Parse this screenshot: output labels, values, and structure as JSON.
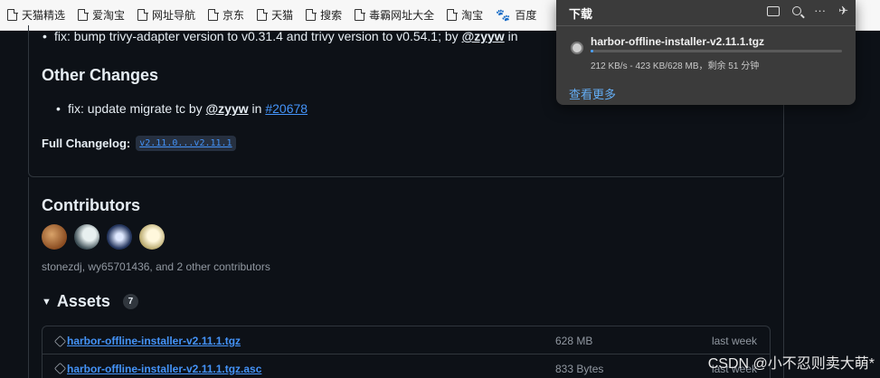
{
  "bookmarks": [
    {
      "label": "天猫精选",
      "icon": "page-icon"
    },
    {
      "label": "爱淘宝",
      "icon": "page-icon"
    },
    {
      "label": "网址导航",
      "icon": "page-icon"
    },
    {
      "label": "京东",
      "icon": "page-icon"
    },
    {
      "label": "天猫",
      "icon": "page-icon"
    },
    {
      "label": "搜索",
      "icon": "page-icon"
    },
    {
      "label": "毒霸网址大全",
      "icon": "page-icon"
    },
    {
      "label": "淘宝",
      "icon": "page-icon"
    },
    {
      "label": "百度",
      "icon": "paw-icon"
    }
  ],
  "release": {
    "line1_text": "fix: bump trivy-adapter version to v0.31.4 and trivy version to v0.54.1; by",
    "line1_user": "@zyyw",
    "line1_in": "in",
    "other_changes_title": "Other Changes",
    "fix2_text": "fix: update migrate tc by",
    "fix2_user": "@zyyw",
    "fix2_in": "in",
    "fix2_pr": "#20678",
    "changelog_label": "Full Changelog:",
    "changelog_range": "v2.11.0...v2.11.1"
  },
  "contributors": {
    "title": "Contributors",
    "names": "stonezdj, wy65701436, and 2 other contributors"
  },
  "assets": {
    "title": "Assets",
    "count": "7",
    "rows": [
      {
        "name": "harbor-offline-installer-v2.11.1.tgz",
        "size": "628 MB",
        "when": "last week"
      },
      {
        "name": "harbor-offline-installer-v2.11.1.tgz.asc",
        "size": "833 Bytes",
        "when": "last week"
      }
    ]
  },
  "download": {
    "title": "下载",
    "file_name": "harbor-offline-installer-v2.11.1.tgz",
    "status": "212 KB/s - 423 KB/628 MB，剩余 51 分钟",
    "progress_fraction": 0.0007,
    "more_link": "查看更多",
    "accent": "#4aa3ff"
  },
  "watermark": "CSDN @小不忍则卖大萌*"
}
